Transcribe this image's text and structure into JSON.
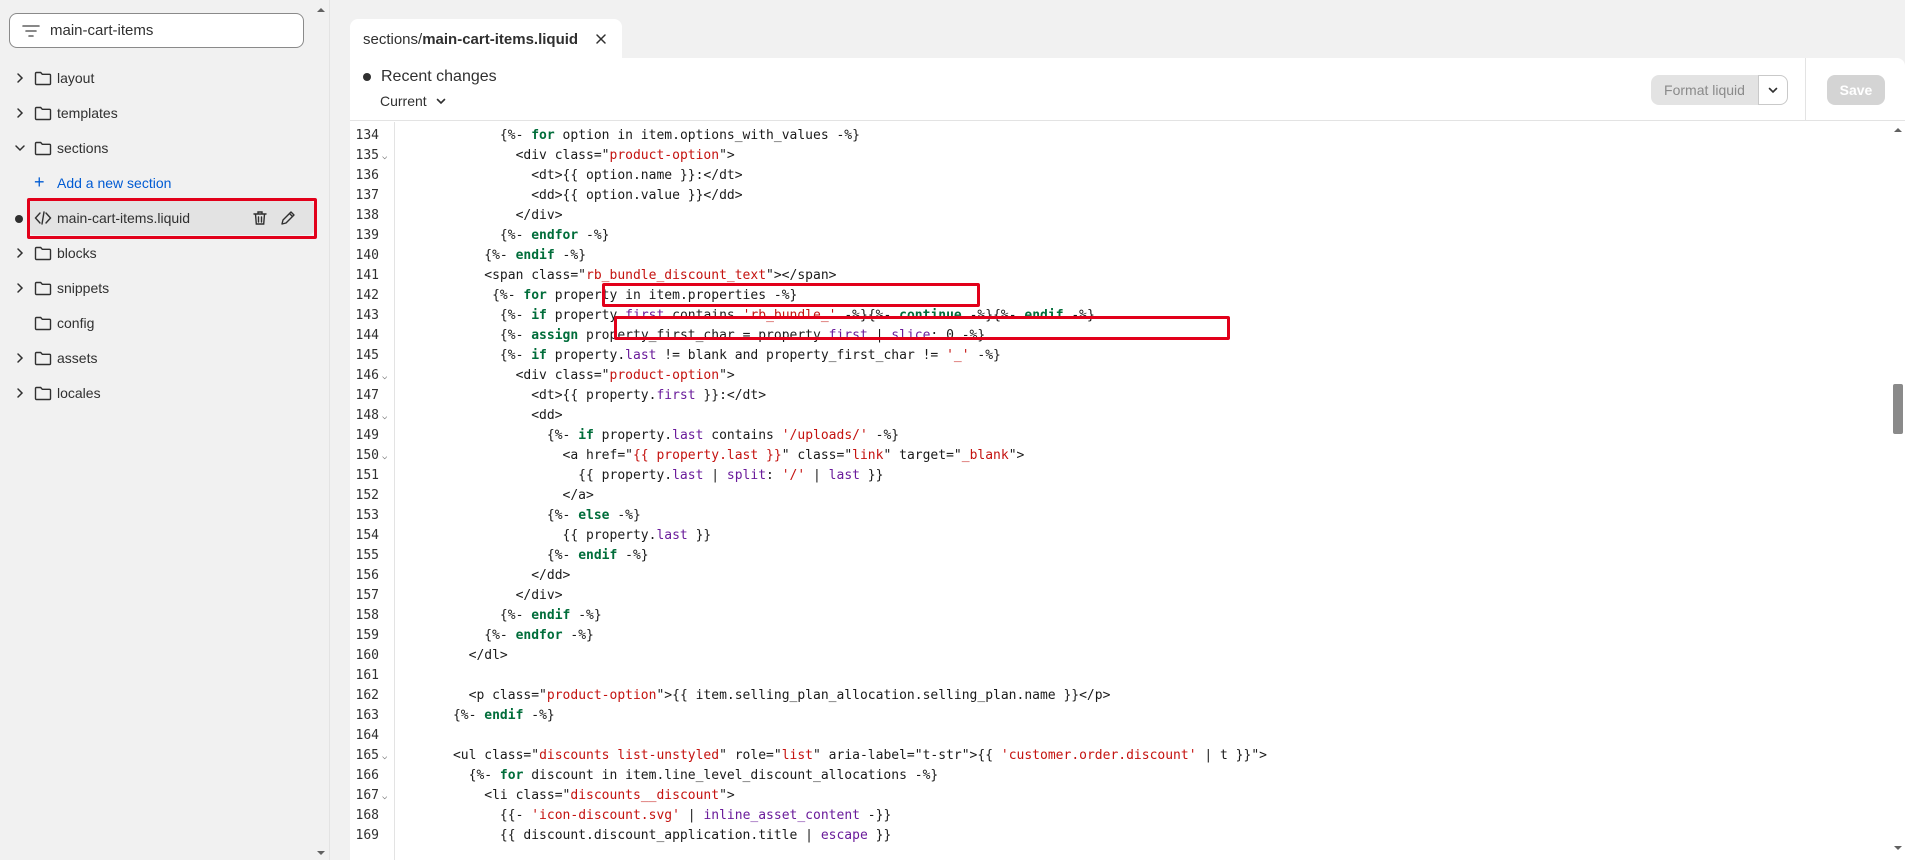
{
  "sidebar": {
    "search_value": "main-cart-items",
    "items": [
      {
        "label": "layout",
        "expanded": false
      },
      {
        "label": "templates",
        "expanded": false
      },
      {
        "label": "sections",
        "expanded": true
      },
      {
        "label": "Add a new section"
      },
      {
        "label": "main-cart-items.liquid"
      },
      {
        "label": "blocks",
        "expanded": false
      },
      {
        "label": "snippets",
        "expanded": false
      },
      {
        "label": "config"
      },
      {
        "label": "assets",
        "expanded": false
      },
      {
        "label": "locales",
        "expanded": false
      }
    ]
  },
  "tab": {
    "path": "sections/",
    "file": "main-cart-items.liquid"
  },
  "header": {
    "recent_changes": "Recent changes",
    "current": "Current",
    "format_label": "Format liquid",
    "save_label": "Save"
  },
  "colors": {
    "highlight": "#e2001a",
    "link": "#005bd3",
    "keyword": "#006d3a",
    "string": "#c4120f"
  },
  "code_lines": [
    {
      "n": "134",
      "fold": false,
      "text": "            {%- for option in item.options_with_values -%}"
    },
    {
      "n": "135",
      "fold": true,
      "text": "              <div class=\"product-option\">"
    },
    {
      "n": "136",
      "fold": false,
      "text": "                <dt>{{ option.name }}:</dt>"
    },
    {
      "n": "137",
      "fold": false,
      "text": "                <dd>{{ option.value }}</dd>"
    },
    {
      "n": "138",
      "fold": false,
      "text": "              </div>"
    },
    {
      "n": "139",
      "fold": false,
      "text": "            {%- endfor -%}"
    },
    {
      "n": "140",
      "fold": false,
      "text": "          {%- endif -%}"
    },
    {
      "n": "141",
      "fold": false,
      "text": "          <span class=\"rb_bundle_discount_text\"></span>"
    },
    {
      "n": "142",
      "fold": false,
      "text": "           {%- for property in item.properties -%}"
    },
    {
      "n": "143",
      "fold": false,
      "text": "            {%- if property.first contains 'rb_bundle_' -%}{%- continue -%}{%- endif -%}"
    },
    {
      "n": "144",
      "fold": false,
      "text": "            {%- assign property_first_char = property.first | slice: 0 -%}"
    },
    {
      "n": "145",
      "fold": false,
      "text": "            {%- if property.last != blank and property_first_char != '_' -%}"
    },
    {
      "n": "146",
      "fold": true,
      "text": "              <div class=\"product-option\">"
    },
    {
      "n": "147",
      "fold": false,
      "text": "                <dt>{{ property.first }}:</dt>"
    },
    {
      "n": "148",
      "fold": true,
      "text": "                <dd>"
    },
    {
      "n": "149",
      "fold": false,
      "text": "                  {%- if property.last contains '/uploads/' -%}"
    },
    {
      "n": "150",
      "fold": true,
      "text": "                    <a href=\"{{ property.last }}\" class=\"link\" target=\"_blank\">"
    },
    {
      "n": "151",
      "fold": false,
      "text": "                      {{ property.last | split: '/' | last }}"
    },
    {
      "n": "152",
      "fold": false,
      "text": "                    </a>"
    },
    {
      "n": "153",
      "fold": false,
      "text": "                  {%- else -%}"
    },
    {
      "n": "154",
      "fold": false,
      "text": "                    {{ property.last }}"
    },
    {
      "n": "155",
      "fold": false,
      "text": "                  {%- endif -%}"
    },
    {
      "n": "156",
      "fold": false,
      "text": "                </dd>"
    },
    {
      "n": "157",
      "fold": false,
      "text": "              </div>"
    },
    {
      "n": "158",
      "fold": false,
      "text": "            {%- endif -%}"
    },
    {
      "n": "159",
      "fold": false,
      "text": "          {%- endfor -%}"
    },
    {
      "n": "160",
      "fold": false,
      "text": "        </dl>"
    },
    {
      "n": "161",
      "fold": false,
      "text": ""
    },
    {
      "n": "162",
      "fold": false,
      "text": "        <p class=\"product-option\">{{ item.selling_plan_allocation.selling_plan.name }}</p>"
    },
    {
      "n": "163",
      "fold": false,
      "text": "      {%- endif -%}"
    },
    {
      "n": "164",
      "fold": false,
      "text": ""
    },
    {
      "n": "165",
      "fold": true,
      "text": "      <ul class=\"discounts list-unstyled\" role=\"list\" aria-label=\"{{ 'customer.order.discount' | t }}\">"
    },
    {
      "n": "166",
      "fold": false,
      "text": "        {%- for discount in item.line_level_discount_allocations -%}"
    },
    {
      "n": "167",
      "fold": true,
      "text": "          <li class=\"discounts__discount\">"
    },
    {
      "n": "168",
      "fold": false,
      "text": "            {{- 'icon-discount.svg' | inline_asset_content -}}"
    },
    {
      "n": "169",
      "fold": false,
      "text": "            {{ discount.discount_application.title | escape }}"
    }
  ]
}
